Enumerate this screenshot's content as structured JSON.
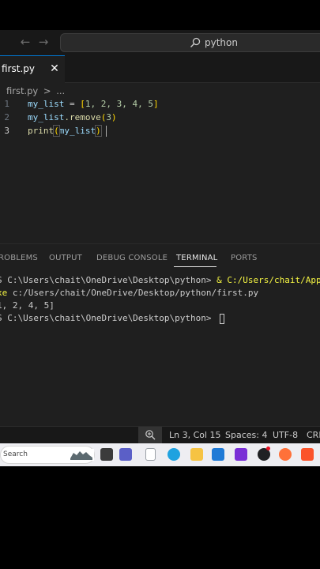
{
  "titlebar": {
    "command_center_text": "python",
    "back_icon": "arrow-left-icon",
    "forward_icon": "arrow-right-icon"
  },
  "tab": {
    "label": "first.py",
    "close_icon": "close-icon"
  },
  "breadcrumb": {
    "file": "first.py",
    "separator": ">",
    "more": "..."
  },
  "editor": {
    "line_numbers": [
      "1",
      "2",
      "3"
    ],
    "lines": [
      {
        "var": "my_list",
        "eq": " = ",
        "open": "[",
        "items": "1, 2, 3, 4, 5",
        "close": "]"
      },
      {
        "var": "my_list",
        "method": ".remove",
        "open": "(",
        "arg": "3",
        "close": ")"
      },
      {
        "fn": "print",
        "open": "(",
        "arg": "my_list",
        "close": ")"
      }
    ]
  },
  "panel": {
    "tabs": [
      "ROBLEMS",
      "OUTPUT",
      "DEBUG CONSOLE",
      "TERMINAL",
      "PORTS"
    ],
    "active_tab": "TERMINAL",
    "terminal": {
      "line1_prompt": "S C:\\Users\\chait\\OneDrive\\Desktop\\python> ",
      "line1_cmd": "& C:/Users/chait/App",
      "line2_exe": "xe",
      "line2_rest": " c:/Users/chait/OneDrive/Desktop/python/first.py",
      "line3_output": "1, 2, 4, 5]",
      "line4_prompt": "S C:\\Users\\chait\\OneDrive\\Desktop\\python> "
    }
  },
  "statusbar": {
    "zoom_icon": "zoom-in-icon",
    "position": "Ln 3, Col 15",
    "spaces": "Spaces: 4",
    "encoding": "UTF-8",
    "eol": "CRL"
  },
  "taskbar": {
    "search_text": "Search",
    "icons": [
      "widget-icon",
      "task-view-icon",
      "teams-icon",
      "file-icon",
      "edge-icon",
      "file-explorer-icon",
      "store-icon",
      "video-editor-icon",
      "chatgpt-icon",
      "firefox-icon",
      "brave-icon"
    ]
  }
}
